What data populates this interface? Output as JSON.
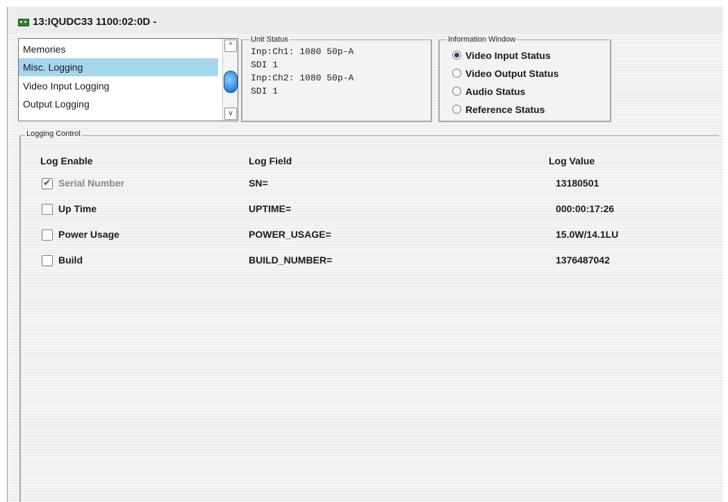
{
  "window": {
    "title": "13:IQUDC33  1100:02:0D  -"
  },
  "menu_list": {
    "items": [
      {
        "label": "Memories",
        "selected": false
      },
      {
        "label": "Misc. Logging",
        "selected": true
      },
      {
        "label": "Video Input Logging",
        "selected": false
      },
      {
        "label": "Output Logging",
        "selected": false
      }
    ],
    "scroll_up": "^",
    "scroll_down": "v"
  },
  "unit_status": {
    "legend": "Unit Status",
    "lines": [
      "Inp:Ch1: 1080 50p-A",
      "SDI 1",
      "Inp:Ch2: 1080 50p-A",
      "SDI 1"
    ]
  },
  "info_window": {
    "legend": "Information Window",
    "options": [
      {
        "label": "Video Input Status",
        "selected": true
      },
      {
        "label": "Video Output Status",
        "selected": false
      },
      {
        "label": "Audio Status",
        "selected": false
      },
      {
        "label": "Reference Status",
        "selected": false
      }
    ]
  },
  "logging": {
    "legend": "Logging Control",
    "headers": {
      "enable": "Log Enable",
      "field": "Log Field",
      "value": "Log Value"
    },
    "rows": [
      {
        "label": "Serial Number",
        "checked": true,
        "disabled": true,
        "field": "SN=",
        "value": "13180501"
      },
      {
        "label": "Up Time",
        "checked": false,
        "disabled": false,
        "field": "UPTIME=",
        "value": "000:00:17:26"
      },
      {
        "label": "Power Usage",
        "checked": false,
        "disabled": false,
        "field": "POWER_USAGE=",
        "value": "15.0W/14.1LU"
      },
      {
        "label": "Build",
        "checked": false,
        "disabled": false,
        "field": "BUILD_NUMBER=",
        "value": "1376487042"
      }
    ]
  },
  "colors": {
    "selection": "#a5d6ee",
    "accent": "#2e8be0",
    "disabled_text": "#8a8a8a"
  }
}
